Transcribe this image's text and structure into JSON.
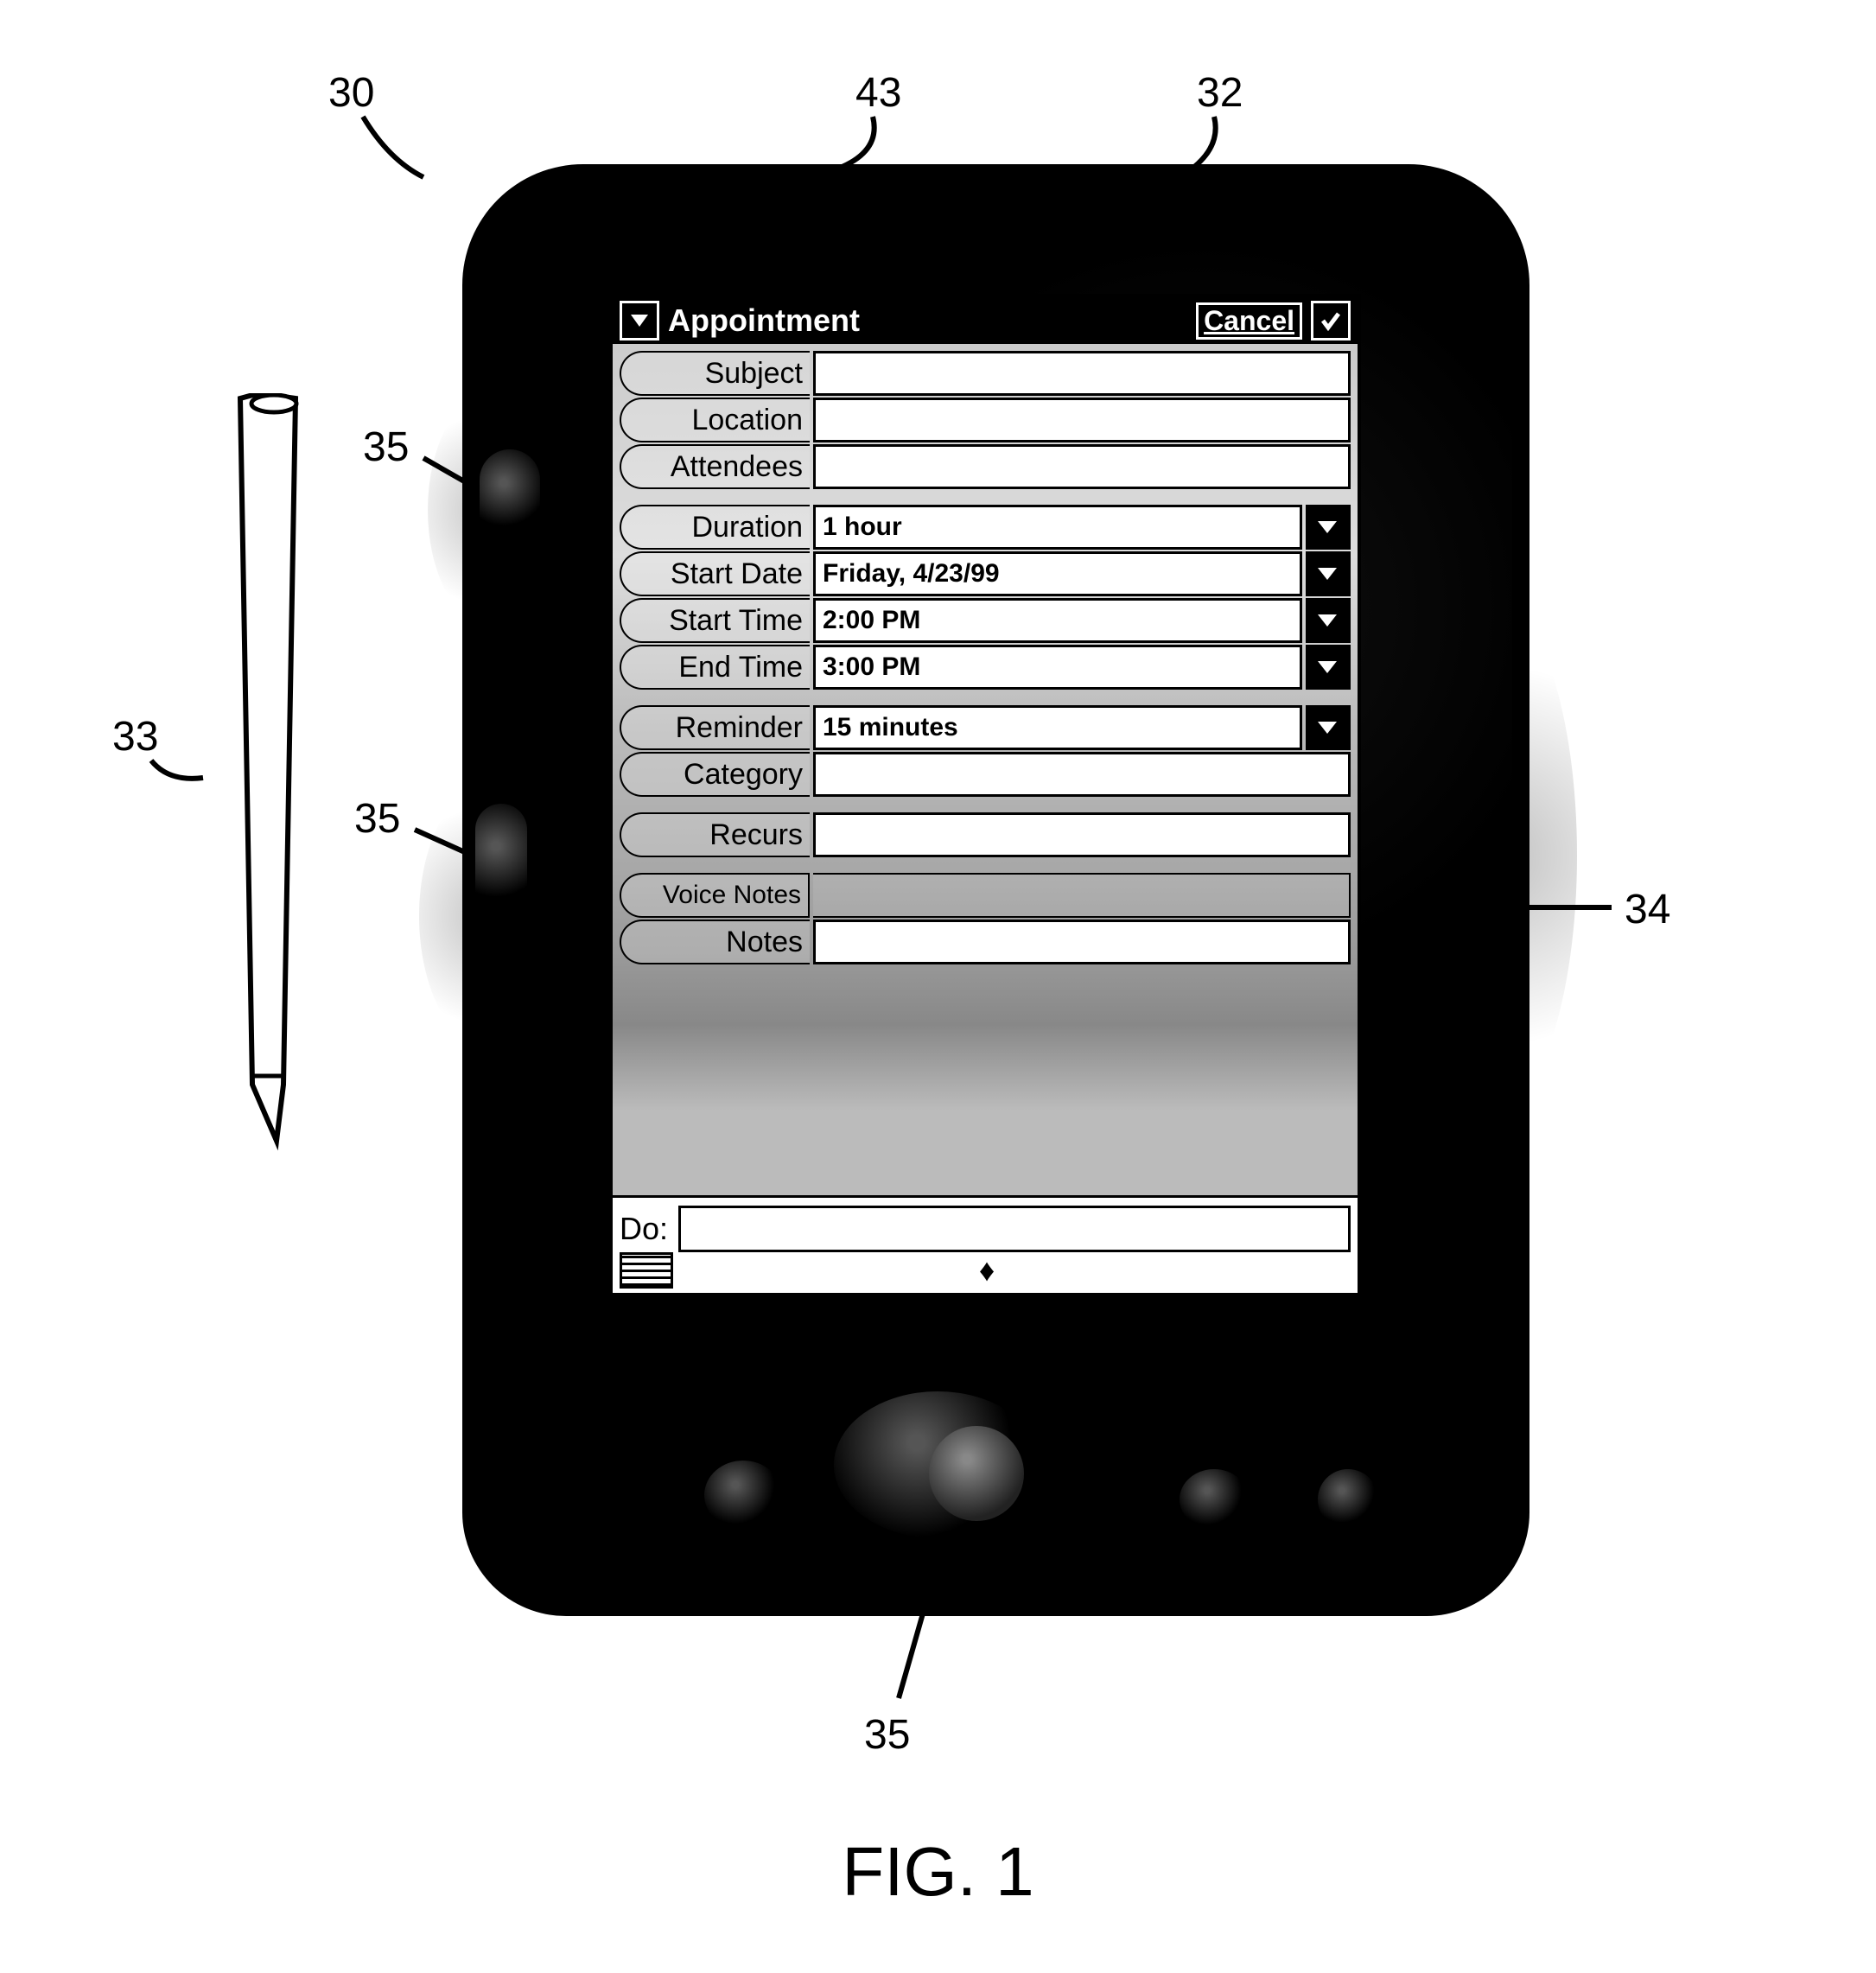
{
  "callouts": {
    "c30": "30",
    "c43": "43",
    "c32": "32",
    "c33": "33",
    "c35a": "35",
    "c35b": "35",
    "c34": "34",
    "c35c": "35"
  },
  "caption": "FIG. 1",
  "titlebar": {
    "title": "Appointment",
    "cancel": "Cancel"
  },
  "fields": {
    "subject_label": "Subject",
    "subject_value": "",
    "location_label": "Location",
    "location_value": "",
    "attendees_label": "Attendees",
    "attendees_value": "",
    "duration_label": "Duration",
    "duration_value": "1 hour",
    "startdate_label": "Start Date",
    "startdate_value": "Friday, 4/23/99",
    "starttime_label": "Start Time",
    "starttime_value": "2:00 PM",
    "endtime_label": "End Time",
    "endtime_value": "3:00 PM",
    "reminder_label": "Reminder",
    "reminder_value": "15 minutes",
    "category_label": "Category",
    "category_value": "",
    "recurs_label": "Recurs",
    "recurs_value": "",
    "voicenotes_label": "Voice Notes",
    "notes_label": "Notes",
    "notes_value": ""
  },
  "bottom": {
    "do_label": "Do:",
    "do_value": ""
  }
}
